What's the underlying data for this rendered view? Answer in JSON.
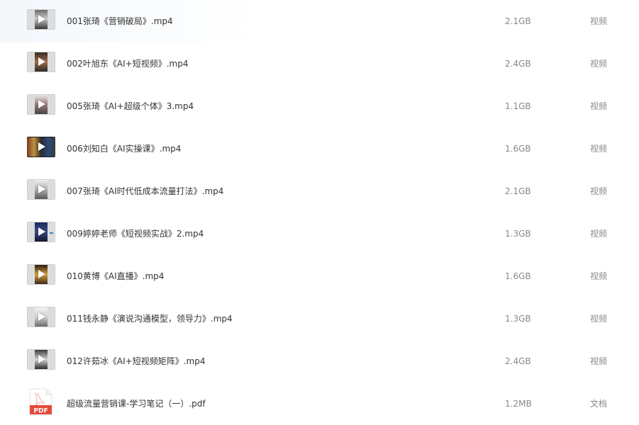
{
  "files": [
    {
      "name": "001张琦《营销破局》.mp4",
      "size": "2.1GB",
      "type": "视频",
      "icon": "video-thumbnail-icon"
    },
    {
      "name": "002叶旭东《AI+短视频》.mp4",
      "size": "2.4GB",
      "type": "视频",
      "icon": "video-thumbnail-icon"
    },
    {
      "name": "005张琦《AI+超级个体》3.mp4",
      "size": "1.1GB",
      "type": "视频",
      "icon": "video-thumbnail-icon"
    },
    {
      "name": "006刘知白《AI实操课》.mp4",
      "size": "1.6GB",
      "type": "视频",
      "icon": "video-thumbnail-icon"
    },
    {
      "name": "007张琦《AI时代低成本流量打法》.mp4",
      "size": "2.1GB",
      "type": "视频",
      "icon": "video-thumbnail-icon"
    },
    {
      "name": "009婷婷老师《短视频实战》2.mp4",
      "size": "1.3GB",
      "type": "视频",
      "icon": "video-thumbnail-icon"
    },
    {
      "name": "010黄博《AI直播》.mp4",
      "size": "1.6GB",
      "type": "视频",
      "icon": "video-thumbnail-icon"
    },
    {
      "name": "011钱永静《演说沟通模型，领导力》.mp4",
      "size": "1.3GB",
      "type": "视频",
      "icon": "video-thumbnail-icon"
    },
    {
      "name": "012许茹冰《AI+短视频矩阵》.mp4",
      "size": "2.4GB",
      "type": "视频",
      "icon": "video-thumbnail-icon"
    },
    {
      "name": "超级流量营销课-学习笔记（一）.pdf",
      "size": "1.2MB",
      "type": "文档",
      "icon": "pdf-file-icon",
      "icon_label": "PDF"
    }
  ],
  "colors": {
    "text": "#333333",
    "muted": "#888888",
    "pdf_red": "#e64a3b"
  }
}
